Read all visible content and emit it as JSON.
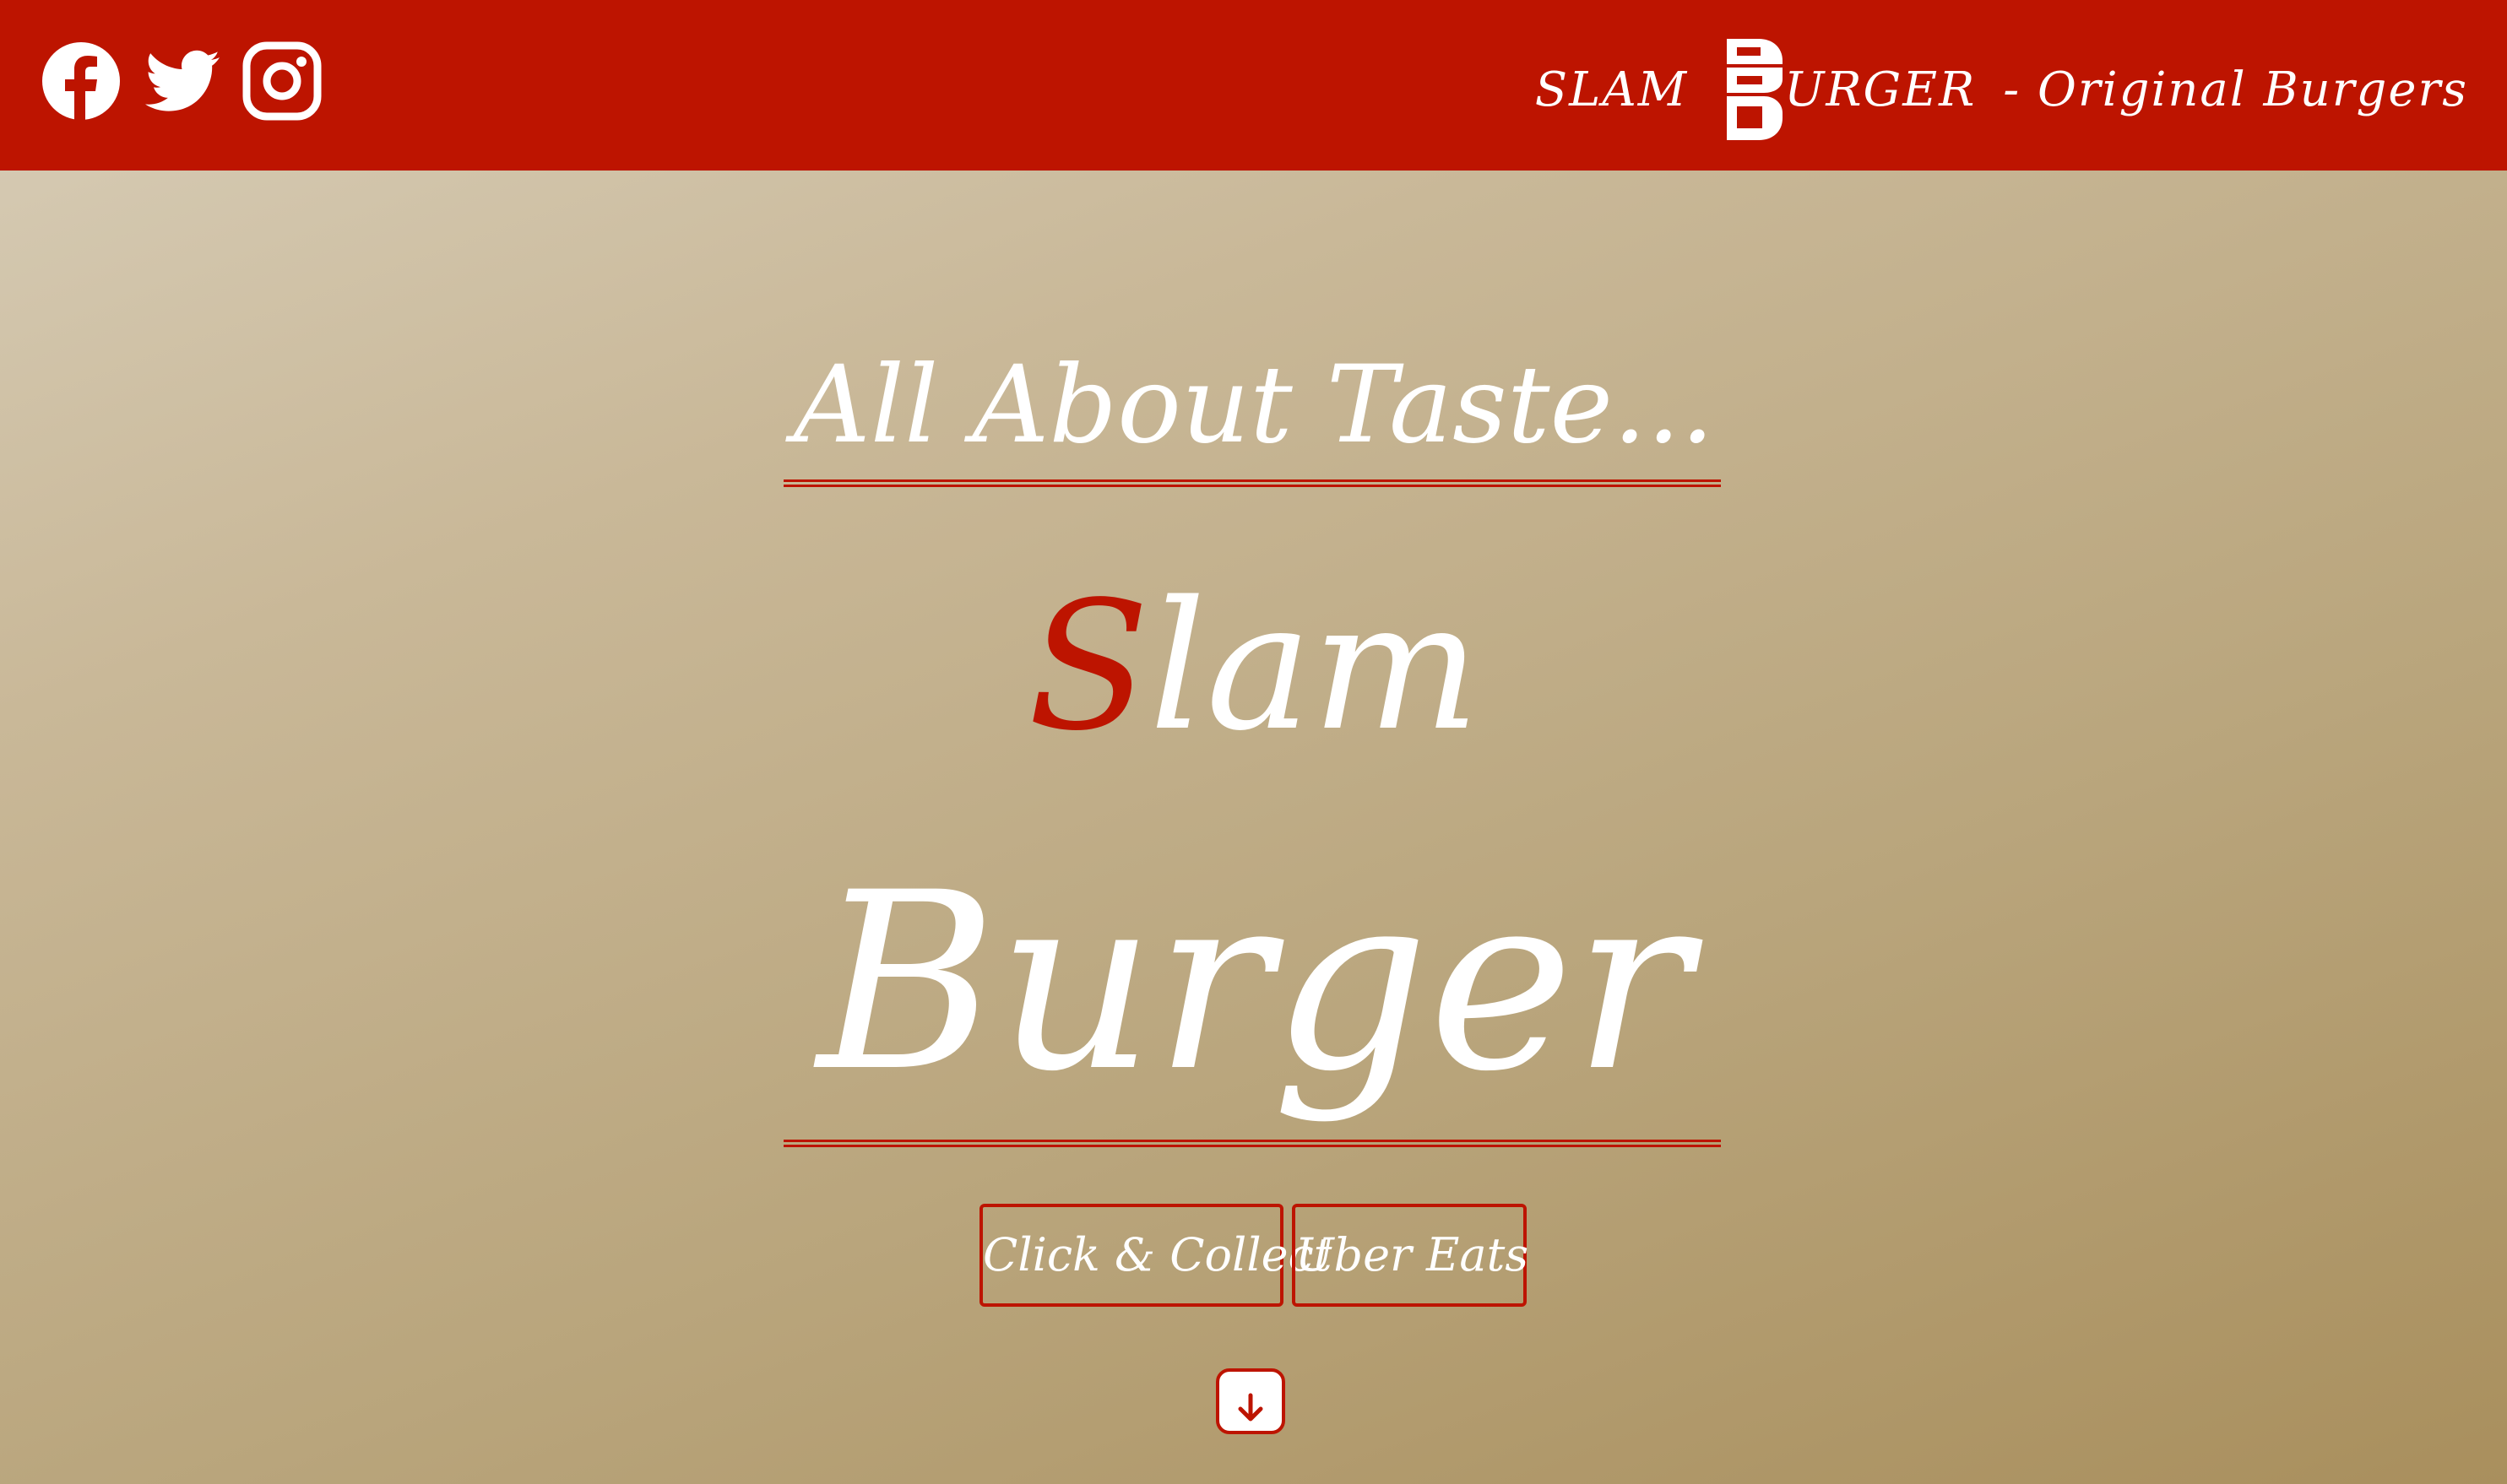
{
  "colors": {
    "brand_red": "#bd1400",
    "text_white": "#ffffff",
    "background_light": "#d8ceb9",
    "background_dark": "#a98f5d"
  },
  "header": {
    "social_icons": [
      "facebook-icon",
      "twitter-icon",
      "instagram-icon"
    ],
    "brand": {
      "slam": "SLAM",
      "logo_icon": "slam-burger-logo-icon",
      "burger_suffix": "URGER",
      "subtitle": "- Original Burgers"
    }
  },
  "hero": {
    "tagline": "All About Taste...",
    "title_initial": "S",
    "title_rest": "lam",
    "title_second": "Burger",
    "buttons": {
      "click_collect": "Click & Collect",
      "uber_eats": "Uber Eats"
    },
    "scroll_icon": "arrow-down-icon"
  }
}
